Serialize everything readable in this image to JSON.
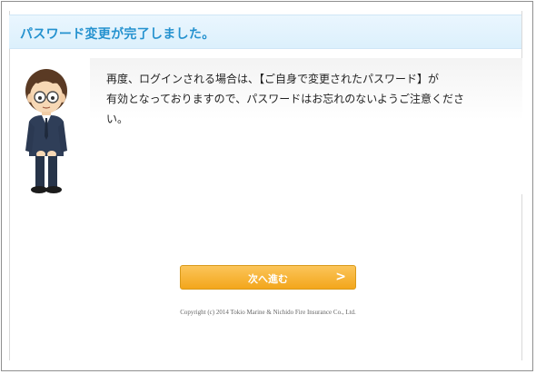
{
  "header": {
    "title": "パスワード変更が完了しました。"
  },
  "message": {
    "text": "再度、ログインされる場合は、【ご自身で変更されたパスワード】が\n有効となっておりますので、パスワードはお忘れのないようご注意くださ\nい。"
  },
  "actions": {
    "next_label": "次へ進む",
    "next_arrow": ">"
  },
  "footer": {
    "copyright": "Copyright (c) 2014 Tokio Marine & Nichido Fire Insurance Co., Ltd."
  },
  "colors": {
    "title": "#2592cf",
    "button": "#f3a61b",
    "border": "#8f8f8f"
  },
  "icons": {
    "avatar": "bowing-man-avatar-icon"
  }
}
